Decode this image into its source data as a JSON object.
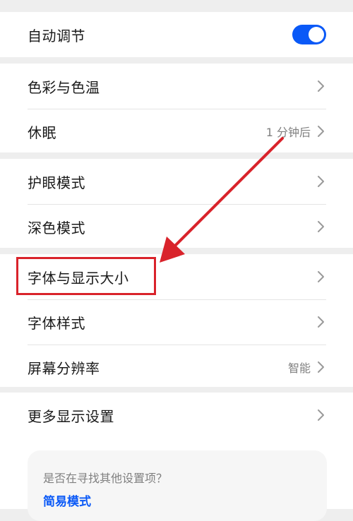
{
  "settings": {
    "auto_adjust": {
      "label": "自动调节",
      "enabled": true
    },
    "group1": [
      {
        "label": "色彩与色温",
        "value": ""
      },
      {
        "label": "休眠",
        "value": "1 分钟后"
      }
    ],
    "group2": [
      {
        "label": "护眼模式",
        "value": ""
      },
      {
        "label": "深色模式",
        "value": ""
      }
    ],
    "group3": [
      {
        "label": "字体与显示大小",
        "value": ""
      },
      {
        "label": "字体样式",
        "value": ""
      },
      {
        "label": "屏幕分辨率",
        "value": "智能"
      }
    ],
    "group4": [
      {
        "label": "更多显示设置",
        "value": ""
      }
    ]
  },
  "suggestion": {
    "question": "是否在寻找其他设置项？",
    "link": "简易模式"
  },
  "colors": {
    "accent": "#0a59f7",
    "annotation": "#d9232b"
  }
}
